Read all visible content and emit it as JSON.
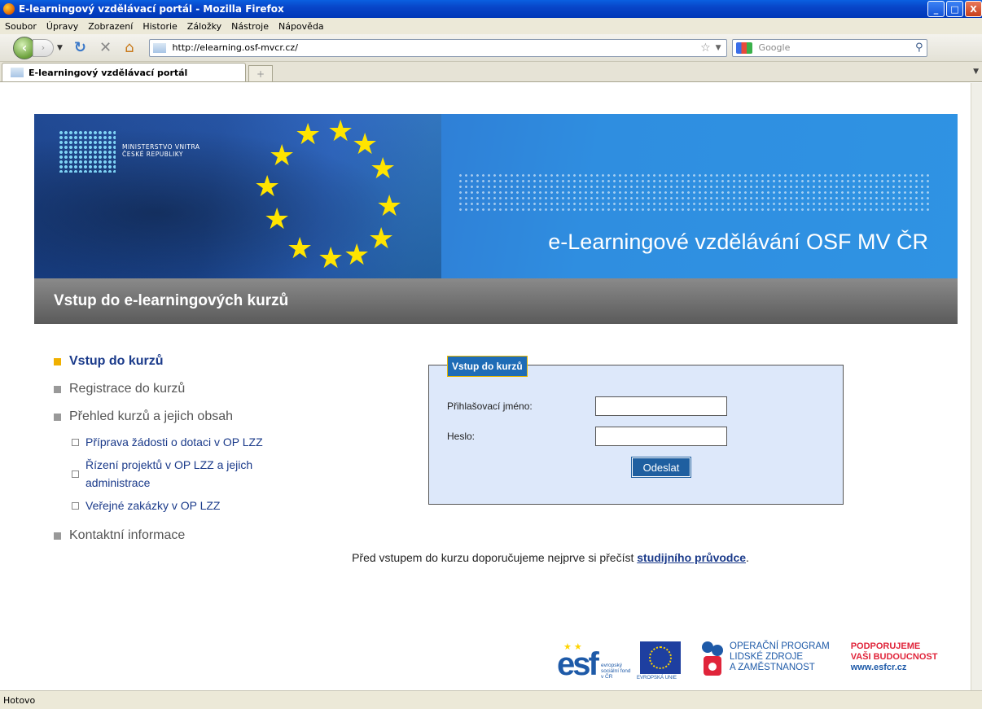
{
  "window": {
    "title": "E-learningový vzdělávací portál - Mozilla Firefox",
    "controls": [
      "_",
      "□",
      "X"
    ]
  },
  "menu": [
    "Soubor",
    "Úpravy",
    "Zobrazení",
    "Historie",
    "Záložky",
    "Nástroje",
    "Nápověda"
  ],
  "navbar": {
    "url": "http://elearning.osf-mvcr.cz/",
    "search_placeholder": "Google"
  },
  "tab": {
    "label": "E-learningový vzdělávací portál"
  },
  "banner": {
    "logo_line1": "MINISTERSTVO VNITRA",
    "logo_line2": "ČESKÉ REPUBLIKY",
    "title": "e-Learningové vzdělávání OSF MV ČR"
  },
  "page": {
    "heading": "Vstup do e-learningových kurzů"
  },
  "sidebar": {
    "items": [
      {
        "label": "Vstup do kurzů"
      },
      {
        "label": "Registrace do kurzů"
      },
      {
        "label": "Přehled kurzů a jejich obsah"
      },
      {
        "label": "Kontaktní informace"
      }
    ],
    "sub_items": [
      {
        "label": "Příprava žádosti o dotaci v OP LZZ"
      },
      {
        "label": "Řízení projektů v OP LZZ a jejich administrace"
      },
      {
        "label": "Veřejné zakázky v OP LZZ"
      }
    ]
  },
  "login": {
    "legend": "Vstup do kurzů",
    "username_label": "Přihlašovací jméno:",
    "username_value": "",
    "password_label": "Heslo:",
    "password_value": "",
    "submit_label": "Odeslat"
  },
  "guide": {
    "text": "Před vstupem do kurzu doporučujeme nejprve si přečíst ",
    "link": "studijního průvodce",
    "end": "."
  },
  "footer": {
    "esf_letters": "esf",
    "esf_caption": "evropský sociální fond v ČR",
    "eu_caption": "EVROPSKÁ UNIE",
    "op_line1": "OPERAČNÍ PROGRAM",
    "op_line2": "LIDSKÉ ZDROJE",
    "op_line3": "A ZAMĚSTNANOST",
    "support_line1": "PODPORUJEME",
    "support_line2": "VAŠI BUDOUCNOST",
    "support_url": "www.esfcr.cz"
  },
  "status": {
    "text": "Hotovo"
  },
  "colors": {
    "banner": "#2f8ee0",
    "heading_bar": "#6e6e6e",
    "login_bg": "#dde8fa",
    "accent": "#1e6cb6",
    "nav_active": "#1a3a8a"
  }
}
